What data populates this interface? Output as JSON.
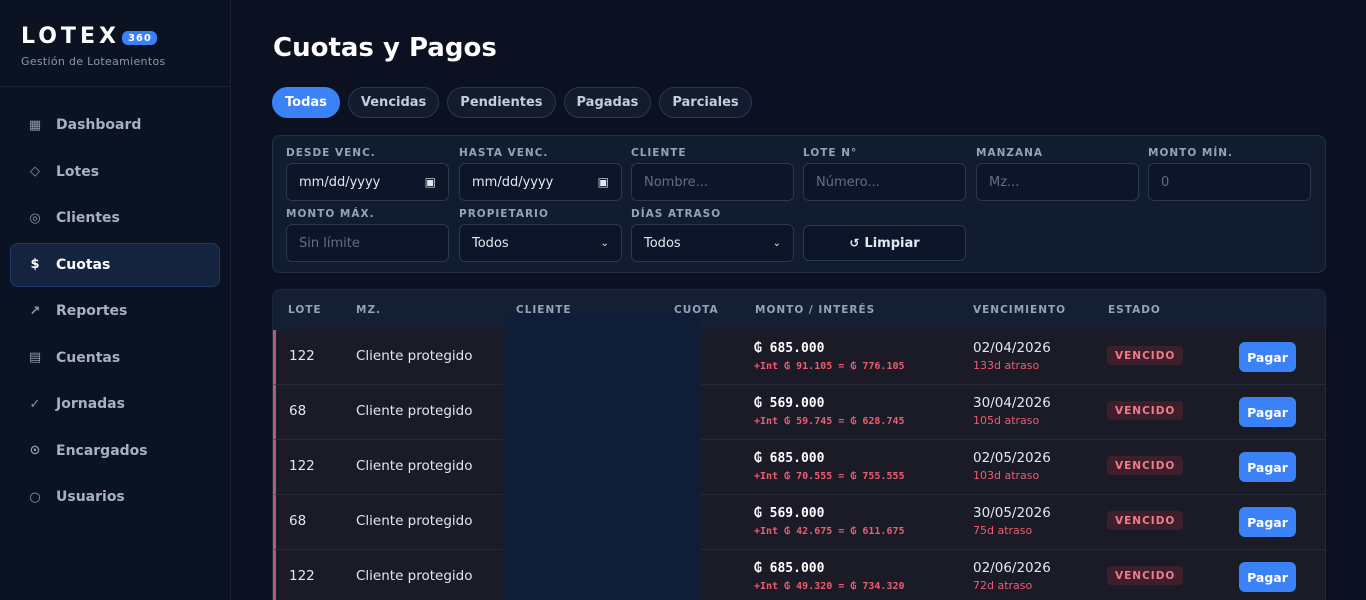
{
  "brand": {
    "name": "LOTEX",
    "badge": "360",
    "subtitle": "Gestión de Loteamientos"
  },
  "sidebar": {
    "items": [
      {
        "label": "Dashboard",
        "icon": "▦",
        "icon_name": "grid-icon",
        "active": false
      },
      {
        "label": "Lotes",
        "icon": "◇",
        "icon_name": "diamond-icon",
        "active": false
      },
      {
        "label": "Clientes",
        "icon": "◎",
        "icon_name": "target-icon",
        "active": false
      },
      {
        "label": "Cuotas",
        "icon": "$",
        "icon_name": "dollar-icon",
        "active": true
      },
      {
        "label": "Reportes",
        "icon": "↗",
        "icon_name": "trend-arrow-icon",
        "active": false
      },
      {
        "label": "Cuentas",
        "icon": "▤",
        "icon_name": "ledger-icon",
        "active": false
      },
      {
        "label": "Jornadas",
        "icon": "✓",
        "icon_name": "check-icon",
        "active": false
      },
      {
        "label": "Encargados",
        "icon": "⊙",
        "icon_name": "person-circle-icon",
        "active": false
      },
      {
        "label": "Usuarios",
        "icon": "○",
        "icon_name": "circle-user-icon",
        "active": false
      }
    ]
  },
  "page": {
    "title": "Cuotas y Pagos"
  },
  "tabs": [
    {
      "label": "Todas",
      "active": true
    },
    {
      "label": "Vencidas",
      "active": false
    },
    {
      "label": "Pendientes",
      "active": false
    },
    {
      "label": "Pagadas",
      "active": false
    },
    {
      "label": "Parciales",
      "active": false
    }
  ],
  "filters": {
    "desde_venc": {
      "label": "DESDE VENC.",
      "value": "mm/dd/yyyy"
    },
    "hasta_venc": {
      "label": "HASTA VENC.",
      "value": "mm/dd/yyyy"
    },
    "cliente": {
      "label": "CLIENTE",
      "placeholder": "Nombre..."
    },
    "lote": {
      "label": "LOTE N°",
      "placeholder": "Número..."
    },
    "manzana": {
      "label": "MANZANA",
      "placeholder": "Mz..."
    },
    "monto_min": {
      "label": "MONTO MÍN.",
      "placeholder": "0"
    },
    "monto_max": {
      "label": "MONTO MÁX.",
      "placeholder": "Sin límite"
    },
    "propietario": {
      "label": "PROPIETARIO",
      "value": "Todos"
    },
    "dias_atraso": {
      "label": "DÍAS ATRASO",
      "value": "Todos"
    },
    "clear_button": {
      "icon": "↺",
      "label": "Limpiar"
    }
  },
  "table": {
    "headers": {
      "lote": "LOTE",
      "mz": "MZ.",
      "cliente": "CLIENTE",
      "cuota": "CUOTA",
      "monto": "MONTO / INTERÉS",
      "vencimiento": "VENCIMIENTO",
      "estado": "ESTADO"
    },
    "rows": [
      {
        "lote": "122",
        "mz": "Cliente protegido",
        "monto": "₲ 685.000",
        "interes": "+Int ₲ 91.105 = ₲ 776.105",
        "vencimiento": "02/04/2026",
        "atraso": "133d atraso",
        "estado": "VENCIDO",
        "accion": "Pagar"
      },
      {
        "lote": "68",
        "mz": "Cliente protegido",
        "monto": "₲ 569.000",
        "interes": "+Int ₲ 59.745 = ₲ 628.745",
        "vencimiento": "30/04/2026",
        "atraso": "105d atraso",
        "estado": "VENCIDO",
        "accion": "Pagar"
      },
      {
        "lote": "122",
        "mz": "Cliente protegido",
        "monto": "₲ 685.000",
        "interes": "+Int ₲ 70.555 = ₲ 755.555",
        "vencimiento": "02/05/2026",
        "atraso": "103d atraso",
        "estado": "VENCIDO",
        "accion": "Pagar"
      },
      {
        "lote": "68",
        "mz": "Cliente protegido",
        "monto": "₲ 569.000",
        "interes": "+Int ₲ 42.675 = ₲ 611.675",
        "vencimiento": "30/05/2026",
        "atraso": "75d atraso",
        "estado": "VENCIDO",
        "accion": "Pagar"
      },
      {
        "lote": "122",
        "mz": "Cliente protegido",
        "monto": "₲ 685.000",
        "interes": "+Int ₲ 49.320 = ₲ 734.320",
        "vencimiento": "02/06/2026",
        "atraso": "72d atraso",
        "estado": "VENCIDO",
        "accion": "Pagar"
      }
    ]
  },
  "colors": {
    "accent": "#3b82f6",
    "danger": "#f05b6f",
    "background": "#0b1120"
  }
}
